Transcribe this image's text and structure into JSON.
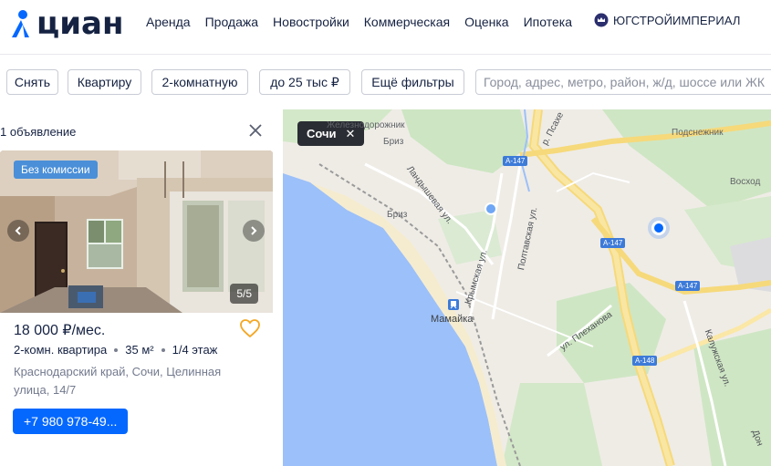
{
  "header": {
    "logo": "циан",
    "nav": [
      "Аренда",
      "Продажа",
      "Новостройки",
      "Коммерческая",
      "Оценка",
      "Ипотека"
    ],
    "partner": "ЮГСТРОЙИМПЕРИАЛ"
  },
  "filters": {
    "deal": "Снять",
    "type": "Квартиру",
    "rooms": "2-комнатную",
    "price": "до 25 тыс ₽",
    "more": "Ещё фильтры",
    "search_placeholder": "Город, адрес, метро, район, ж/д, шоссе или ЖК"
  },
  "panel": {
    "count": "1 объявление",
    "listing": {
      "badge": "Без комиссии",
      "photo_counter": "5/5",
      "price": "18 000 ₽/мес.",
      "rooms": "2-комн. квартира",
      "area": "35 м²",
      "floor": "1/4 этаж",
      "address": "Краснодарский край, Сочи, Целинная улица, 14/7",
      "phone": "+7 980 978-49..."
    }
  },
  "map": {
    "city_chip": "Сочи",
    "labels": {
      "zheleznodorozhnik": "Железнодорожник",
      "briz_top": "Бриз",
      "briz": "Бриз",
      "podsnezhnik": "Подснежник",
      "voskhod": "Восход",
      "mamayka": "Мамайка",
      "psakhe": "р. Псахе",
      "landyshevaya": "Ландышевая ул.",
      "krymskaya": "Крымская ул.",
      "poltavskaya": "Полтавская ул.",
      "plekhanova": "ул. Плеханова",
      "kaluzhskaya": "Калужская ул.",
      "don": "Дон"
    },
    "highways": [
      "А-147",
      "А-147",
      "А-147",
      "А-148"
    ]
  },
  "colors": {
    "brand": "#0468ff",
    "badge": "#4a8fd8",
    "water": "#9cc0f9",
    "heart": "#f5a623"
  }
}
